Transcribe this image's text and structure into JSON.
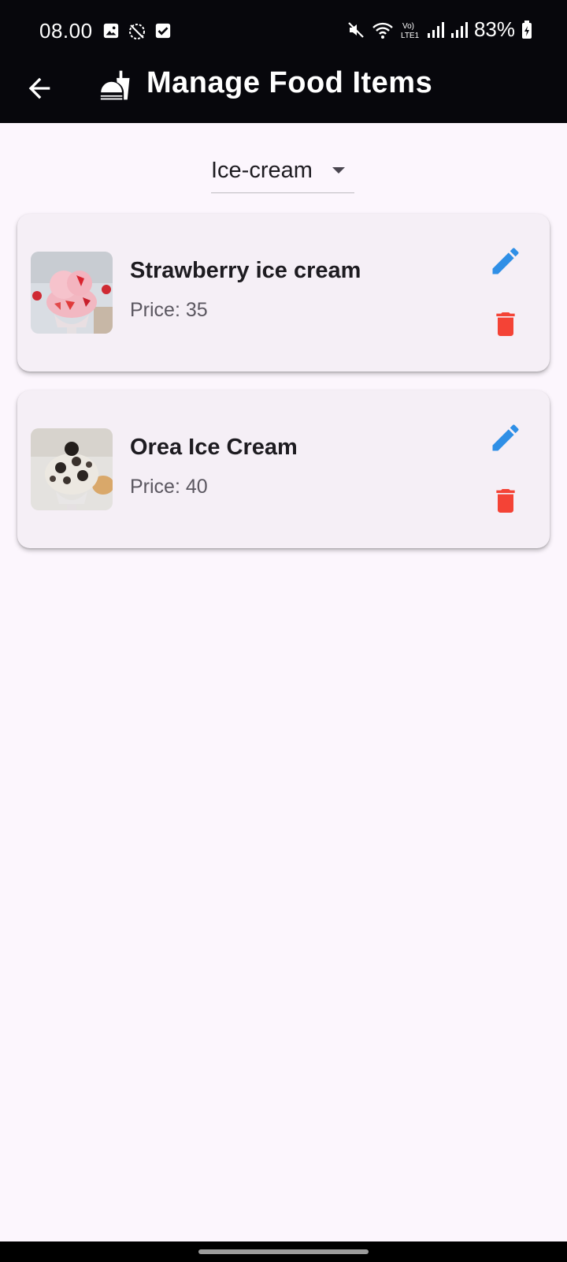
{
  "status_bar": {
    "time": "08.00",
    "battery": "83%",
    "icons": [
      "image-icon",
      "sync-off-icon",
      "checkbox-icon",
      "mute-icon",
      "wifi-icon",
      "volte-icon",
      "signal-icon",
      "signal-icon",
      "battery-charging-icon"
    ]
  },
  "app_bar": {
    "back_icon": "arrow-back-icon",
    "logo_icon": "fastfood-icon",
    "title": "Manage Food Items"
  },
  "category_dropdown": {
    "selected": "Ice-cream"
  },
  "items": [
    {
      "name": "Strawberry ice cream",
      "price": "Price: 35",
      "thumb": "strawberry-ice-cream-photo"
    },
    {
      "name": "Orea Ice Cream",
      "price": "Price: 40",
      "thumb": "oreo-ice-cream-photo"
    }
  ],
  "colors": {
    "bar_background": "#07070c",
    "page_background": "#fcf6fd",
    "card_background": "#f5eff6",
    "edit_icon": "#2f8fe6",
    "delete_icon": "#f44336"
  }
}
